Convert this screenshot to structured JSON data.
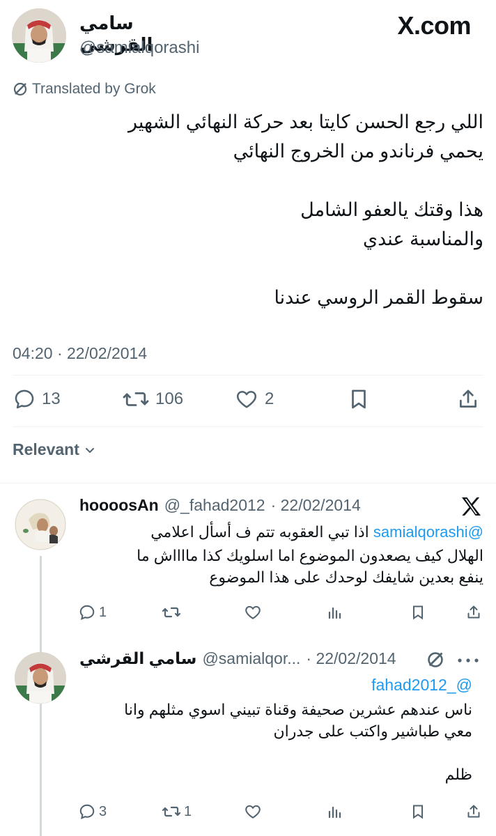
{
  "site": {
    "brand": "X.com"
  },
  "tweet": {
    "author_name": "سامي القرشي",
    "author_handle": "@samialqorashi",
    "translated_label": "Translated by Grok",
    "text": "اللي رجع الحسن كايتا بعد حركة النهائي الشهير\nيحمي فرناندو من الخروج النهائي\n\nهذا وقتك يالعفو الشامل\nوالمناسبة عندي\n\nسقوط القمر الروسي عندنا",
    "timestamp": "04:20 · 22/02/2014",
    "stats": {
      "replies": "13",
      "retweets": "106",
      "likes": "2"
    }
  },
  "sort": {
    "label": "Relevant"
  },
  "replies": [
    {
      "author_name": "hoooosAn",
      "author_handle": "@_fahad2012",
      "date": "· 22/02/2014",
      "mention": "@samialqorashi",
      "text_first": "اذا تبي العقوبه تتم ف أسأل اعلامي",
      "text_rest": "الهلال كيف يصعدون الموضوع اما اسلويك كذا مااااش ما\nينفع بعدين شايفك لوحدك على هذا الموضوع",
      "stats": {
        "replies": "1",
        "retweets": "",
        "likes": ""
      }
    },
    {
      "author_name": "سامي القرشي",
      "author_handle": "@samialqor...",
      "date": "· 22/02/2014",
      "mention": "@_fahad2012",
      "text": "ناس عندهم عشرين صحيفة وقناة تبيني اسوي مثلهم وانا\nمعي طباشير واكتب على جدران\n\nظلم",
      "stats": {
        "replies": "3",
        "retweets": "1",
        "likes": ""
      }
    }
  ],
  "colors": {
    "text": "#0f1419",
    "muted": "#536471",
    "link": "#1d9bf0"
  }
}
